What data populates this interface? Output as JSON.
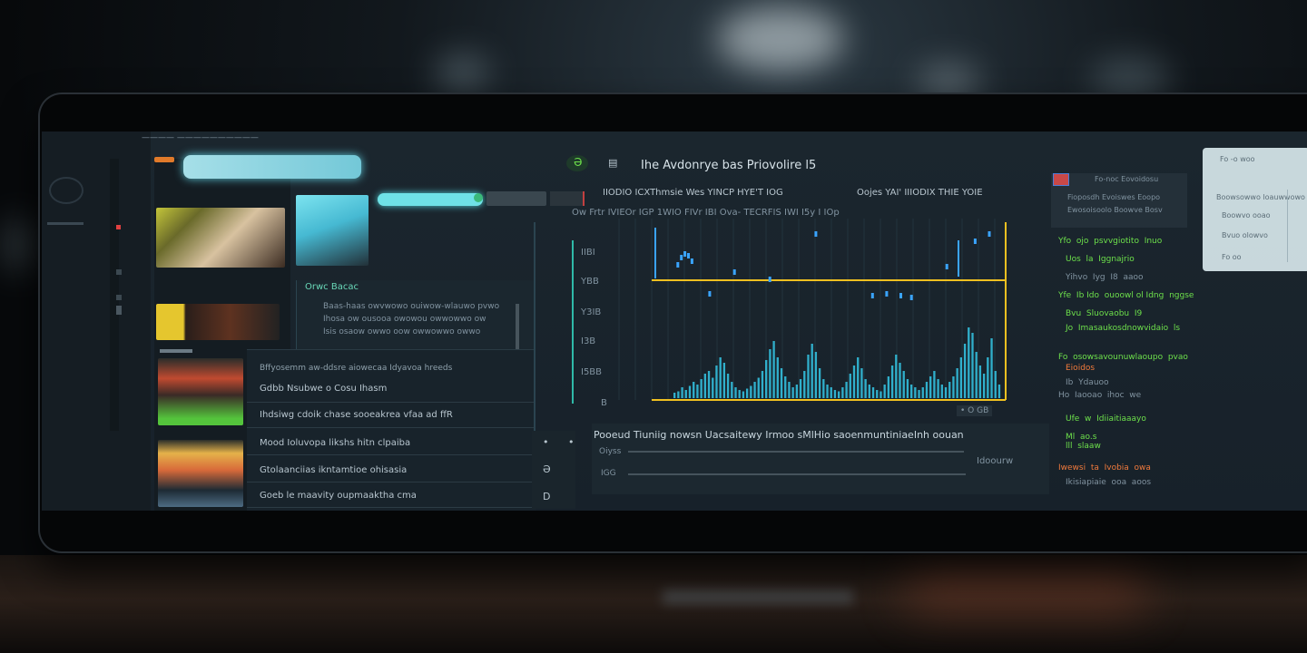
{
  "app": {
    "title": "Ihe Avdonrye  bas  Priovolire  l5",
    "icon_label": "Ə",
    "menu_icon": "menu-icon",
    "breadcrumb": "———— ——————————"
  },
  "toolbar": {
    "search_placeholder": "",
    "tab_active": "",
    "tab_secondary": ""
  },
  "chart_header": {
    "row1_left": "IIODIO ICXThmsie  Wes YINCP  HYE'T  IOG",
    "row1_right": "Oojes  YAI'  IIIODIX THIE  YOIE",
    "row2": "Ow  Frtr    IVIEOr  IGP    1WIO   FIVr  IBI    Ova-    TECRFIS  IWI   I5y   I IOp"
  },
  "chart_data": {
    "type": "bar",
    "yticks": [
      "IIBI",
      "YBB",
      "Y3IB",
      "I3B",
      "I5BB",
      "B"
    ],
    "footer_label": "• O GB",
    "threshold_color": "#f0c020",
    "bar_color": "#35c8e8",
    "bars": [
      4,
      5,
      8,
      6,
      9,
      12,
      10,
      14,
      18,
      20,
      15,
      24,
      30,
      26,
      18,
      12,
      8,
      6,
      5,
      7,
      9,
      12,
      15,
      20,
      28,
      36,
      42,
      30,
      22,
      16,
      12,
      8,
      10,
      14,
      20,
      32,
      40,
      34,
      22,
      14,
      10,
      8,
      6,
      5,
      8,
      12,
      18,
      24,
      30,
      22,
      14,
      10,
      8,
      6,
      5,
      10,
      16,
      24,
      32,
      26,
      20,
      14,
      10,
      8,
      6,
      8,
      12,
      16,
      20,
      14,
      10,
      8,
      12,
      16,
      22,
      30,
      40,
      52,
      48,
      34,
      24,
      18,
      30,
      44,
      20,
      10
    ],
    "dots": [
      {
        "x": 0.07,
        "y": 0.22
      },
      {
        "x": 0.08,
        "y": 0.18
      },
      {
        "x": 0.09,
        "y": 0.16
      },
      {
        "x": 0.1,
        "y": 0.17
      },
      {
        "x": 0.11,
        "y": 0.2
      },
      {
        "x": 0.16,
        "y": 0.38
      },
      {
        "x": 0.23,
        "y": 0.26
      },
      {
        "x": 0.33,
        "y": 0.3
      },
      {
        "x": 0.46,
        "y": 0.05
      },
      {
        "x": 0.62,
        "y": 0.39
      },
      {
        "x": 0.66,
        "y": 0.38
      },
      {
        "x": 0.7,
        "y": 0.39
      },
      {
        "x": 0.73,
        "y": 0.4
      },
      {
        "x": 0.83,
        "y": 0.23
      },
      {
        "x": 0.91,
        "y": 0.09
      },
      {
        "x": 0.95,
        "y": 0.05
      }
    ]
  },
  "bottom_panel": {
    "title": "Pooeud  Tiuniig  nowsn   Uacsaitewy  Irmoo sMlHio saoenmuntiniaeInh oouan",
    "label1": "Oiyss",
    "label2": "IGG",
    "side_label": "Idoourw"
  },
  "sidebar": {
    "section_title": "Orwc  Bacac",
    "rows": [
      "Bffyosemm  aw-ddsre  aiowecaa  Idyavoa hreeds",
      "Gdbb  Nsubwe  o  Cosu Ihasm",
      "Ihdsiwg  cdoik  chase  sooeakrea vfaa ad  ffR",
      "Mood  Ioluvopa  likshs  hitn  clpaiba",
      "Gtolaanciias  ikntamtioe  ohisasia",
      "Goeb  le  maavity  oupmaaktha  cma"
    ],
    "row_values": [
      "",
      "",
      "",
      "•",
      "Ə",
      "D"
    ],
    "list_lines": [
      "Baas-haas  owvwowo  ouiwow-wlauwo  pvwo",
      "Ihosa  ow  ousooa  owowou  owwowwo  ow",
      "Isis  osaow  owwo  oow  owwowwo  owwo"
    ]
  },
  "right_column": {
    "top_lines": [
      "Fo-noc  Eovoidosu",
      "Fioposdh Evoiswes Eoopo",
      "Ewosoisoolo Boowve  Bosv"
    ],
    "lines": [
      {
        "text": "Yfo  ojo  psvvgiotito  Inuo",
        "tone": "grn"
      },
      {
        "text": "Uos  la  Iggnajrio",
        "tone": "grn"
      },
      {
        "text": "Yihvo  Iyg  I8  aaoo",
        "tone": "dim"
      },
      {
        "text": "Yfe  Ib Ido  ouoowl ol Idng  nggse",
        "tone": "grn"
      },
      {
        "text": "Bvu  Sluovaobu  I9",
        "tone": "grn"
      },
      {
        "text": "Jo  Imasaukosdnowvidaio  ls",
        "tone": "grn"
      },
      {
        "text": "Fo  osowsavounuwlaoupo  pvao",
        "tone": "grn"
      },
      {
        "text": "Eioidos",
        "tone": "orn"
      },
      {
        "text": "Ib  Ydauoo",
        "tone": "dim"
      },
      {
        "text": "Ho  Iaooao  ihoc  we",
        "tone": "dim"
      },
      {
        "text": "Ufe  w  Idiiaitiaaayo",
        "tone": "grn"
      },
      {
        "text": "Ml  ao.s\nlll  slaaw",
        "tone": "grn"
      },
      {
        "text": "Iwewsi  ta  Ivobia  owa",
        "tone": "orn"
      },
      {
        "text": "Ikisiapiaie  ooa  aoos",
        "tone": "dim"
      }
    ],
    "card_lines": [
      "Fo -o  woo",
      "Boowsowwo  loauwwowo",
      "Boowvo  ooao",
      "Bvuo  olowvo",
      "Fo  oo"
    ]
  }
}
